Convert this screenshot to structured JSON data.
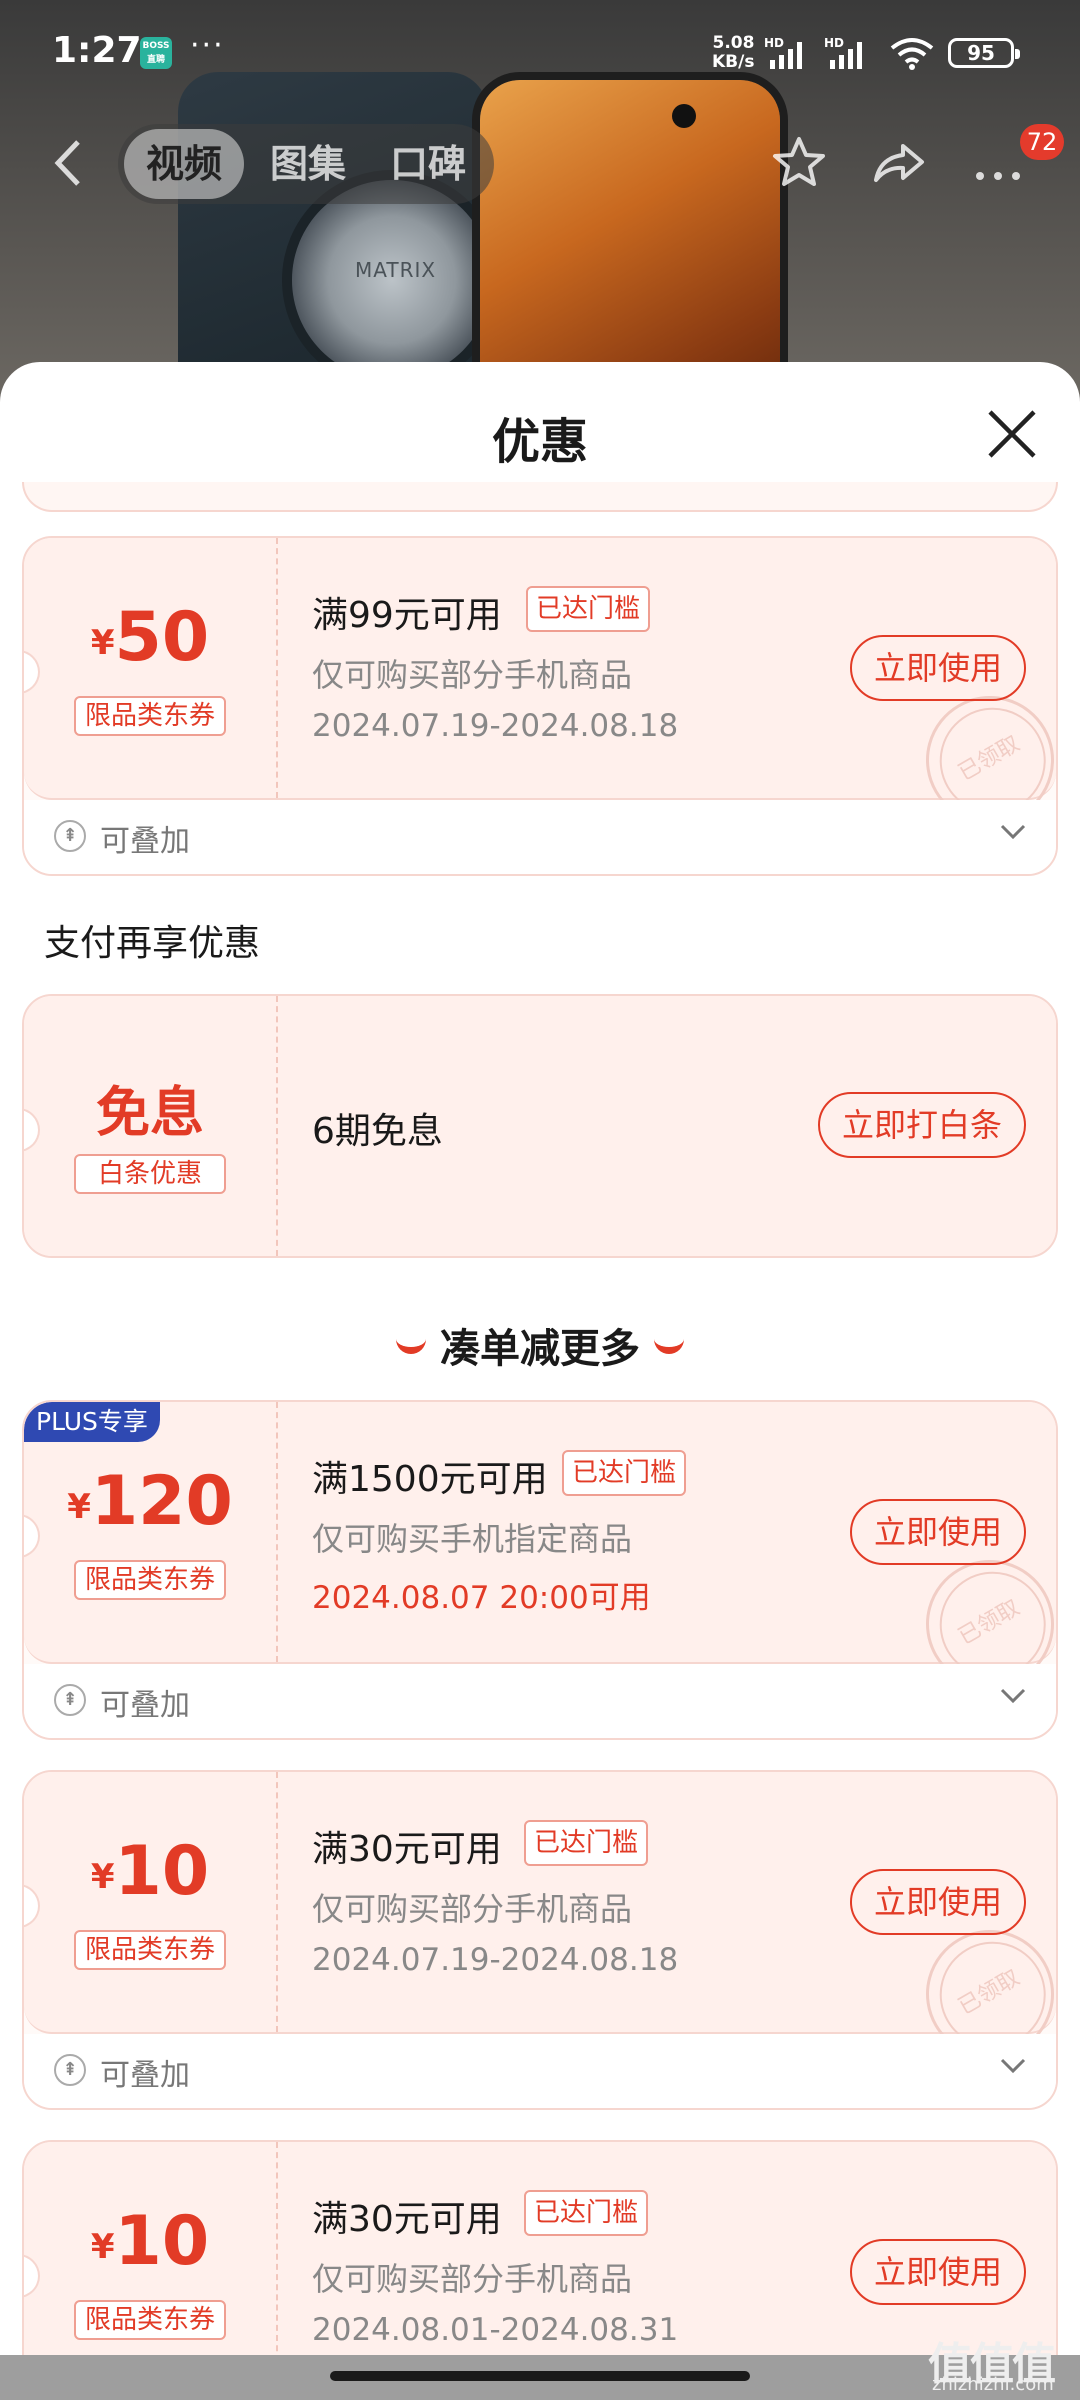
{
  "status_bar": {
    "time": "1:27",
    "app_badge": "BOSS直聘",
    "more": "···",
    "net_speed_value": "5.08",
    "net_speed_unit": "KB/s",
    "battery": "95"
  },
  "nav": {
    "tabs": [
      {
        "label": "视频",
        "active": true
      },
      {
        "label": "图集",
        "active": false
      },
      {
        "label": "口碑",
        "active": false
      }
    ],
    "badge": "72"
  },
  "product_image": {
    "camera_text": "MATRIX"
  },
  "sheet": {
    "title": "优惠",
    "coupons": [
      {
        "yen": "¥",
        "amount": "50",
        "type_tag": "限品类东券",
        "condition": "满99元可用",
        "reached": "已达门槛",
        "scope": "仅可购买部分手机商品",
        "validity": "2024.07.19-2024.08.18",
        "button": "立即使用",
        "stamp": "已领取",
        "stackable": "可叠加"
      }
    ],
    "pay_section": {
      "title": "支付再享优惠",
      "card": {
        "headline": "免息",
        "type_tag": "白条优惠",
        "text": "6期免息",
        "button": "立即打白条"
      }
    },
    "more_section": {
      "title": "凑单减更多",
      "coupons": [
        {
          "badge": "PLUS专享",
          "yen": "¥",
          "amount": "120",
          "type_tag": "限品类东券",
          "condition": "满1500元可用",
          "reached": "已达门槛",
          "scope": "仅可购买手机指定商品",
          "validity": "2024.08.07 20:00可用",
          "button": "立即使用",
          "stamp": "已领取",
          "stackable": "可叠加"
        },
        {
          "yen": "¥",
          "amount": "10",
          "type_tag": "限品类东券",
          "condition": "满30元可用",
          "reached": "已达门槛",
          "scope": "仅可购买部分手机商品",
          "validity": "2024.07.19-2024.08.18",
          "button": "立即使用",
          "stamp": "已领取",
          "stackable": "可叠加"
        },
        {
          "yen": "¥",
          "amount": "10",
          "type_tag": "限品类东券",
          "condition": "满30元可用",
          "reached": "已达门槛",
          "scope": "仅可购买部分手机商品",
          "validity": "2024.08.01-2024.08.31",
          "button": "立即使用"
        }
      ]
    }
  },
  "watermark": {
    "logo": "值值值",
    "url": "zhizhizhi.com"
  },
  "colors": {
    "accent": "#e23b26",
    "plus": "#2f49b2",
    "card_bg": "#fff0ec",
    "border": "#f6d6cf"
  },
  "icons": [
    "back-arrow-icon",
    "star-icon",
    "share-icon",
    "more-icon",
    "close-icon",
    "stack-icon",
    "chevron-down-icon",
    "wifi-icon",
    "signal-icon",
    "battery-icon"
  ]
}
